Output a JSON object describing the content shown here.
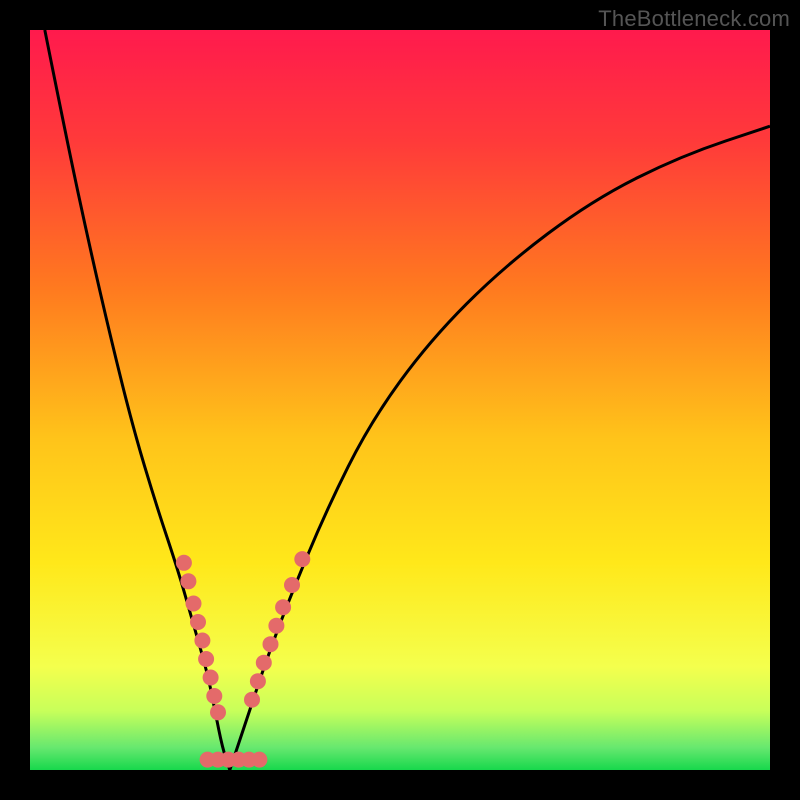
{
  "watermark": "TheBottleneck.com",
  "colors": {
    "frame_bg": "#000000",
    "gradient_stops": [
      {
        "offset": 0.0,
        "color": "#ff1a4d"
      },
      {
        "offset": 0.15,
        "color": "#ff3a3a"
      },
      {
        "offset": 0.35,
        "color": "#ff7a1f"
      },
      {
        "offset": 0.55,
        "color": "#ffc31a"
      },
      {
        "offset": 0.72,
        "color": "#ffe81a"
      },
      {
        "offset": 0.86,
        "color": "#f4ff4d"
      },
      {
        "offset": 0.92,
        "color": "#c8ff5a"
      },
      {
        "offset": 0.97,
        "color": "#66e86f"
      },
      {
        "offset": 1.0,
        "color": "#17d84c"
      }
    ],
    "curve": "#000000",
    "dots": "#e46a6a"
  },
  "chart_data": {
    "type": "line",
    "title": "",
    "xlabel": "",
    "ylabel": "",
    "xlim": [
      0,
      100
    ],
    "ylim": [
      0,
      100
    ],
    "vertex_x": 27,
    "series": [
      {
        "name": "left-branch",
        "x": [
          2,
          5,
          8,
          11,
          14,
          17,
          20,
          22,
          24,
          25,
          26,
          27
        ],
        "values": [
          100,
          85,
          71,
          58,
          46,
          36,
          27,
          20,
          13,
          8,
          3,
          0
        ]
      },
      {
        "name": "right-branch",
        "x": [
          27,
          28,
          30,
          32,
          35,
          40,
          46,
          54,
          64,
          76,
          88,
          100
        ],
        "values": [
          0,
          3,
          9,
          15,
          23,
          35,
          47,
          58,
          68,
          77,
          83,
          87
        ]
      }
    ],
    "dot_clusters": {
      "left_branch": [
        {
          "x": 20.8,
          "y": 28.0
        },
        {
          "x": 21.4,
          "y": 25.5
        },
        {
          "x": 22.1,
          "y": 22.5
        },
        {
          "x": 22.7,
          "y": 20.0
        },
        {
          "x": 23.3,
          "y": 17.5
        },
        {
          "x": 23.8,
          "y": 15.0
        },
        {
          "x": 24.4,
          "y": 12.5
        },
        {
          "x": 24.9,
          "y": 10.0
        },
        {
          "x": 25.4,
          "y": 7.8
        }
      ],
      "right_branch": [
        {
          "x": 30.0,
          "y": 9.5
        },
        {
          "x": 30.8,
          "y": 12.0
        },
        {
          "x": 31.6,
          "y": 14.5
        },
        {
          "x": 32.5,
          "y": 17.0
        },
        {
          "x": 33.3,
          "y": 19.5
        },
        {
          "x": 34.2,
          "y": 22.0
        },
        {
          "x": 35.4,
          "y": 25.0
        },
        {
          "x": 36.8,
          "y": 28.5
        }
      ],
      "bottom": [
        {
          "x": 24.0,
          "y": 1.4
        },
        {
          "x": 25.4,
          "y": 1.4
        },
        {
          "x": 26.8,
          "y": 1.4
        },
        {
          "x": 28.2,
          "y": 1.4
        },
        {
          "x": 29.6,
          "y": 1.4
        },
        {
          "x": 31.0,
          "y": 1.4
        }
      ]
    }
  }
}
